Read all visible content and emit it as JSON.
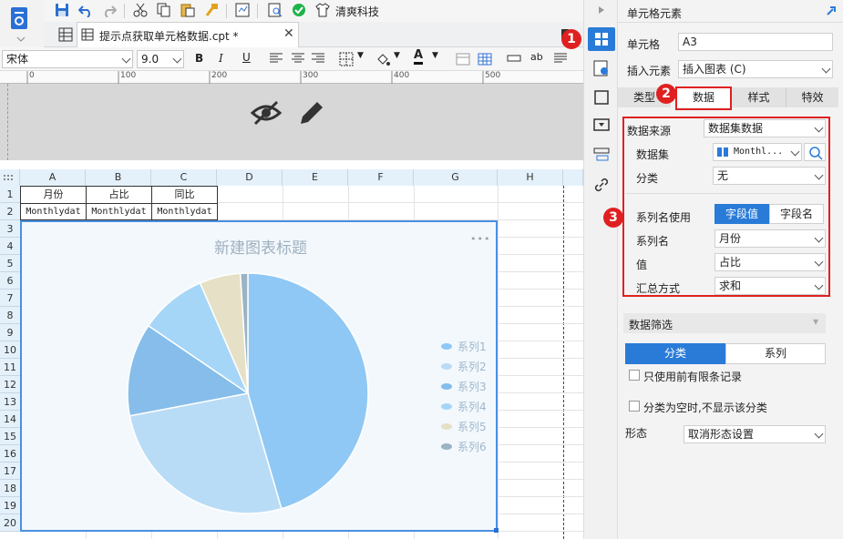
{
  "toolbar": {
    "brand_label": "清爽科技"
  },
  "tab": {
    "filename": "提示点获取单元格数据.cpt *"
  },
  "format": {
    "font": "宋体",
    "size": "9.0",
    "ab_label": "ab"
  },
  "ruler": {
    "ticks": [
      "0",
      "100",
      "200",
      "300",
      "400",
      "500"
    ]
  },
  "sheet": {
    "columns": [
      "A",
      "B",
      "C",
      "D",
      "E",
      "F",
      "G",
      "H"
    ],
    "rows": [
      "1",
      "2",
      "3",
      "4",
      "5",
      "6",
      "7",
      "8",
      "9",
      "10",
      "11",
      "12",
      "13",
      "14",
      "15",
      "16",
      "17",
      "18",
      "19",
      "20"
    ],
    "row1": [
      "月份",
      "占比",
      "同比"
    ],
    "row2": [
      "Monthlydat",
      "Monthlydat",
      "Monthlydat"
    ]
  },
  "chart": {
    "title": "新建图表标题",
    "menu": "•••",
    "legend": [
      "系列1",
      "系列2",
      "系列3",
      "系列4",
      "系列5",
      "系列6"
    ],
    "colors": [
      "#8fc8f4",
      "#b9dcf6",
      "#86bdea",
      "#a6d6f7",
      "#e6e0c6",
      "#9bb3c3"
    ]
  },
  "chart_data": {
    "type": "pie",
    "title": "新建图表标题",
    "series": [
      {
        "name": "系列1",
        "value": 45.5
      },
      {
        "name": "系列2",
        "value": 26.5
      },
      {
        "name": "系列3",
        "value": 12.5
      },
      {
        "name": "系列4",
        "value": 9.0
      },
      {
        "name": "系列5",
        "value": 5.5
      },
      {
        "name": "系列6",
        "value": 1.0
      }
    ],
    "legend_position": "right"
  },
  "panel": {
    "header": "单元格元素",
    "cell_label": "单元格",
    "cell_value": "A3",
    "insert_label": "插入元素",
    "insert_value": "插入图表 (C)",
    "tabs": [
      "类型",
      "数据",
      "样式",
      "特效"
    ],
    "source_label": "数据来源",
    "source_value": "数据集数据",
    "dataset_label": "数据集",
    "dataset_value": "Monthl...",
    "category_label": "分类",
    "category_value": "无",
    "series_name_use_label": "系列名使用",
    "seg_field_value": "字段值",
    "seg_field_name": "字段名",
    "series_name_label": "系列名",
    "series_name_value": "月份",
    "value_label": "值",
    "value_value": "占比",
    "agg_label": "汇总方式",
    "agg_value": "求和",
    "filter_label": "数据筛选",
    "filter_tabs": [
      "分类",
      "系列"
    ],
    "check1": "只使用前有限条记录",
    "check2": "分类为空时,不显示该分类",
    "shape_label": "形态",
    "shape_value": "取消形态设置"
  },
  "badges": [
    "1",
    "2",
    "3"
  ]
}
